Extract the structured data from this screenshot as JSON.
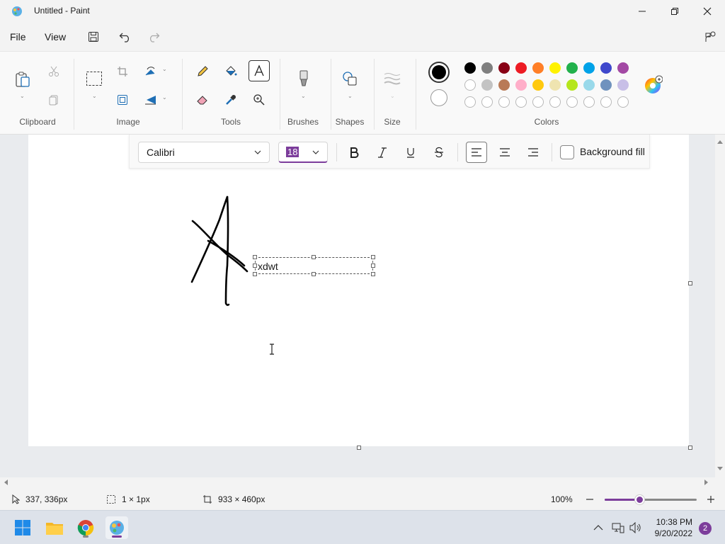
{
  "window": {
    "title": "Untitled - Paint"
  },
  "menu": {
    "file": "File",
    "view": "View"
  },
  "ribbon": {
    "groups": {
      "clipboard": "Clipboard",
      "image": "Image",
      "tools": "Tools",
      "brushes": "Brushes",
      "shapes": "Shapes",
      "size": "Size",
      "colors": "Colors"
    },
    "active_tool": "text",
    "primary_color": "#000000",
    "secondary_color": "#ffffff",
    "palette_row1": [
      "#000000",
      "#7f7f7f",
      "#880015",
      "#ed1c24",
      "#ff7f27",
      "#fff200",
      "#22b14c",
      "#00a2e8",
      "#3f48cc",
      "#a349a4"
    ],
    "palette_row2": [
      "#ffffff",
      "#c3c3c3",
      "#b97a57",
      "#ffaec9",
      "#ffc90e",
      "#efe4b0",
      "#b5e61d",
      "#99d9ea",
      "#7092be",
      "#c8bfe7"
    ]
  },
  "text_toolbar": {
    "font": "Calibri",
    "size": "18",
    "background_fill": "Background fill",
    "alignment": "left"
  },
  "canvas": {
    "text_content": "xdwt"
  },
  "status": {
    "cursor_pos": "337, 336px",
    "selection_size": "1 × 1px",
    "canvas_size": "933 × 460px",
    "zoom": "100%",
    "zoom_level": 0.38
  },
  "taskbar": {
    "time": "10:38 PM",
    "date": "9/20/2022",
    "notifications": "2"
  }
}
